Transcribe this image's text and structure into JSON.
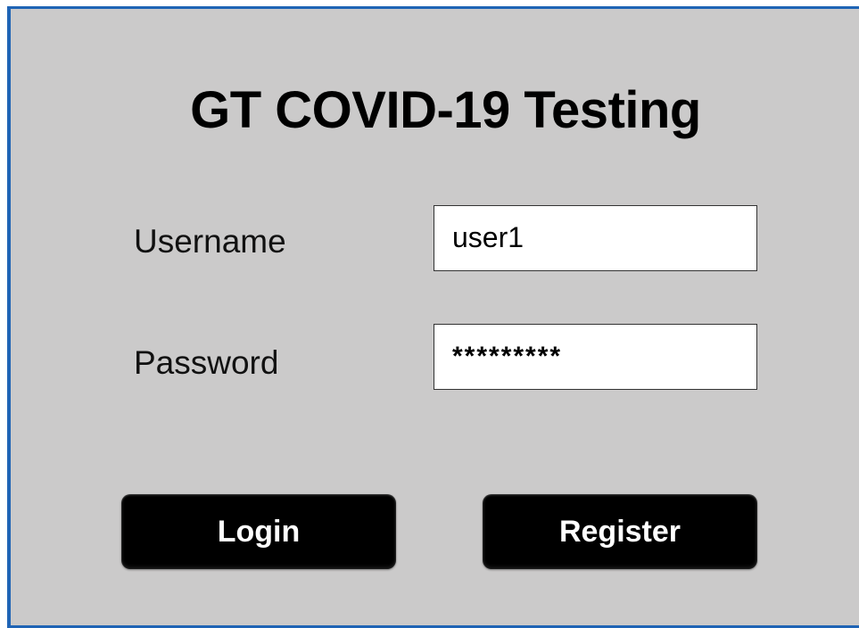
{
  "app": {
    "title": "GT COVID-19 Testing"
  },
  "form": {
    "username_label": "Username",
    "username_value": "user1",
    "password_label": "Password",
    "password_value": "*********"
  },
  "actions": {
    "login_label": "Login",
    "register_label": "Register"
  },
  "colors": {
    "window_border": "#1f64b5",
    "background": "#cbcaca",
    "button_bg": "#000000",
    "button_text": "#ffffff"
  }
}
